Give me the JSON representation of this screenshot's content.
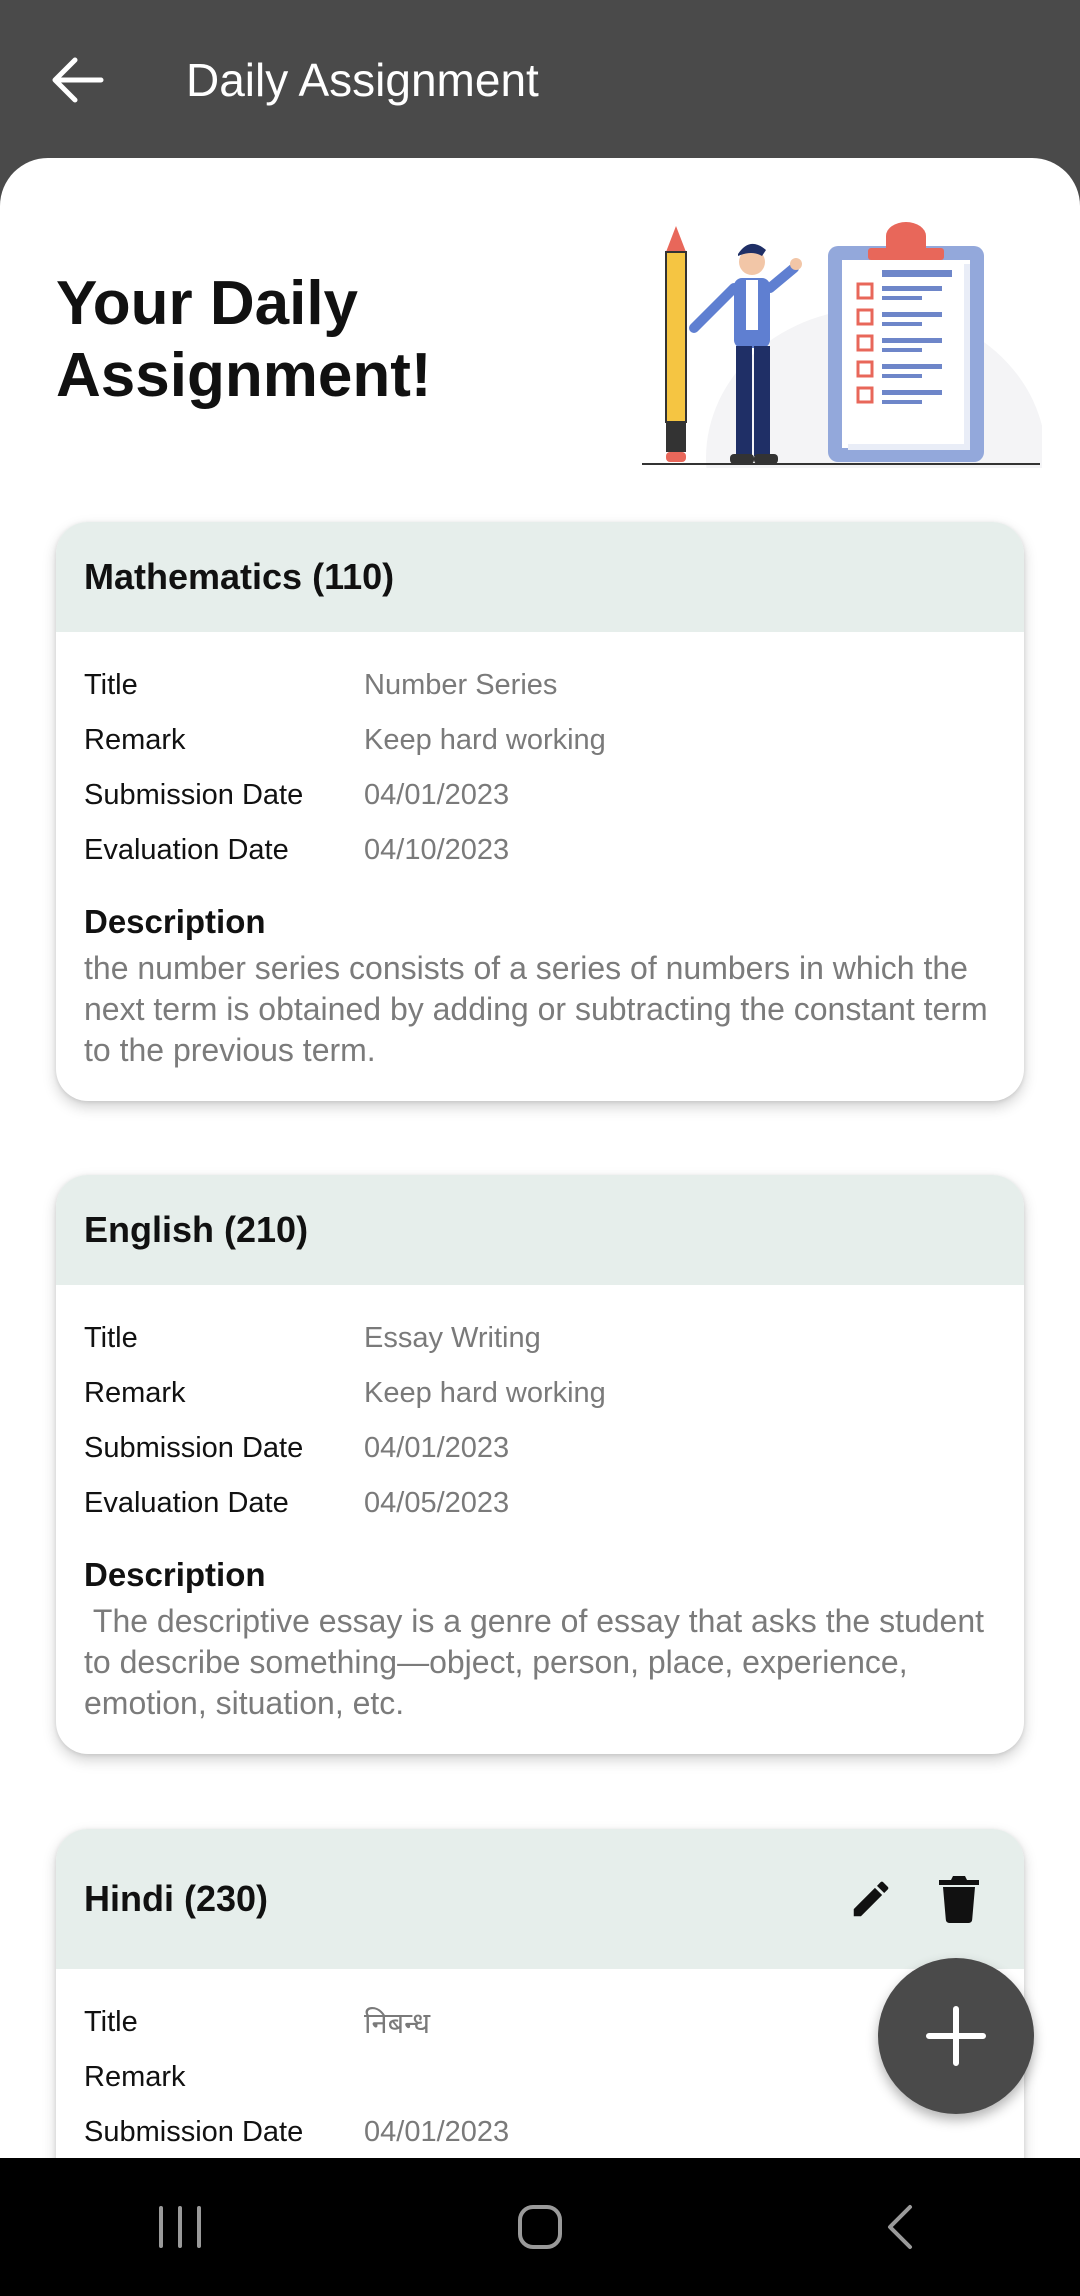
{
  "appbar": {
    "title": "Daily Assignment"
  },
  "hero": {
    "title": "Your Daily Assignment!"
  },
  "labels": {
    "title": "Title",
    "remark": "Remark",
    "submission_date": "Submission Date",
    "evaluation_date": "Evaluation Date",
    "description": "Description"
  },
  "assignments": [
    {
      "subject": "Mathematics (110)",
      "title": "Number Series",
      "remark": "Keep hard working",
      "submission_date": "04/01/2023",
      "evaluation_date": "04/10/2023",
      "description": "the number series consists of a series of numbers in which the next term is obtained by adding or subtracting the constant term to the previous term."
    },
    {
      "subject": "English (210)",
      "title": "Essay Writing",
      "remark": "Keep hard working",
      "submission_date": "04/01/2023",
      "evaluation_date": "04/05/2023",
      "description": " The descriptive essay is a genre of essay that asks the student to describe something—object, person, place, experience, emotion, situation, etc."
    },
    {
      "subject": "Hindi (230)",
      "title": "निबन्ध",
      "remark": "",
      "submission_date": "04/01/2023"
    }
  ],
  "icons": {
    "back": "arrow-left-icon",
    "edit": "pencil-icon",
    "delete": "trash-icon",
    "add": "plus-icon",
    "nav_recents": "recents-icon",
    "nav_home": "home-icon",
    "nav_back": "chevron-left-icon"
  },
  "colors": {
    "appbar": "#4a4a4a",
    "card_header": "#e6eeeb",
    "fab": "#4a4a4a"
  }
}
